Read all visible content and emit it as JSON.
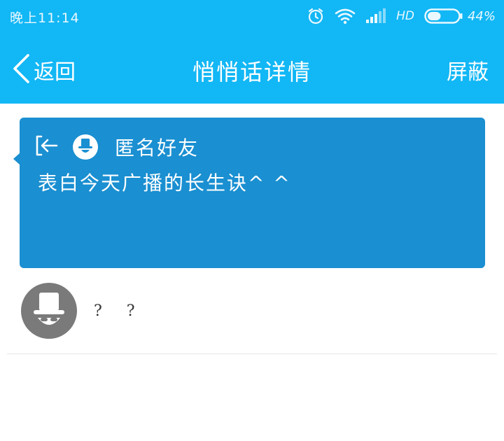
{
  "status_bar": {
    "time": "晚上11:14",
    "network_label": "HD",
    "battery_percent": "44%",
    "battery_level": 0.44,
    "icons": [
      "alarm-icon",
      "wifi-icon",
      "signal-icon",
      "battery-icon"
    ]
  },
  "header": {
    "back_label": "返回",
    "title": "悄悄话详情",
    "block_label": "屏蔽"
  },
  "message": {
    "sender": "匿名好友",
    "text": "表白今天广播的长生诀^ ^"
  },
  "reply": {
    "text": "? ?"
  },
  "colors": {
    "header_blue": "#12b7f5",
    "card_blue": "#1a8fd1",
    "avatar_gray": "#7a7a7a"
  }
}
